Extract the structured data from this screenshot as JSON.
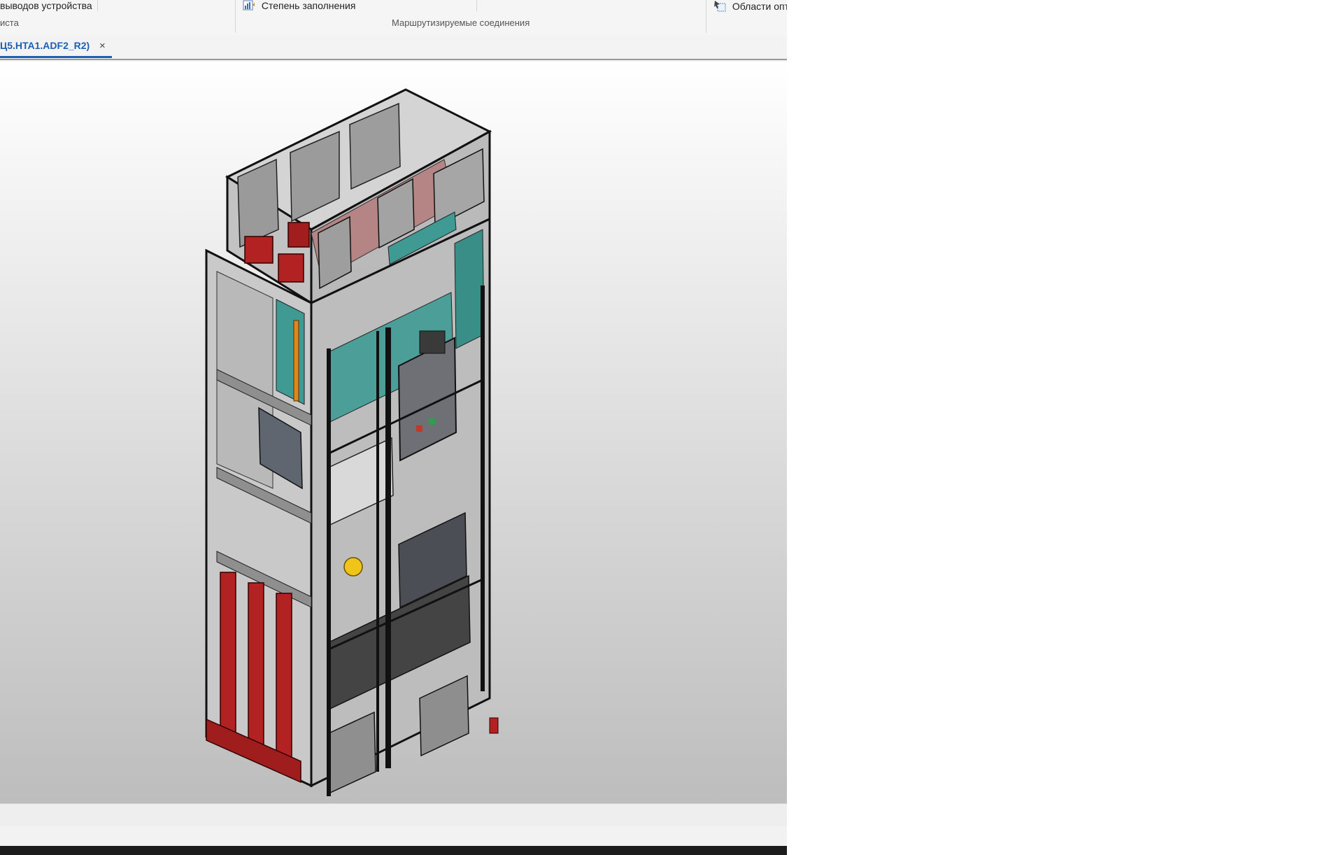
{
  "ribbon": {
    "item_left": "выводов устройства",
    "item_fill": "Степень заполнения",
    "item_areas": "Области опт",
    "group_left": "иста",
    "group_routed": "Маршрутизируемые соединения"
  },
  "tabs": [
    {
      "label": "Ц5.HTA1.ADF2_R2)",
      "close": "×"
    }
  ],
  "status": {
    "text": ""
  },
  "colors": {
    "accent": "#1e5fb5",
    "busbar_red": "#b32222",
    "mounting_teal": "#3f9a93",
    "frame": "#1a1a1a",
    "glass": "#9a9a9a"
  },
  "icons": {
    "fill_icon": "bar-chart-icon",
    "areas_icon": "area-select-icon",
    "close_icon": "close-icon"
  }
}
